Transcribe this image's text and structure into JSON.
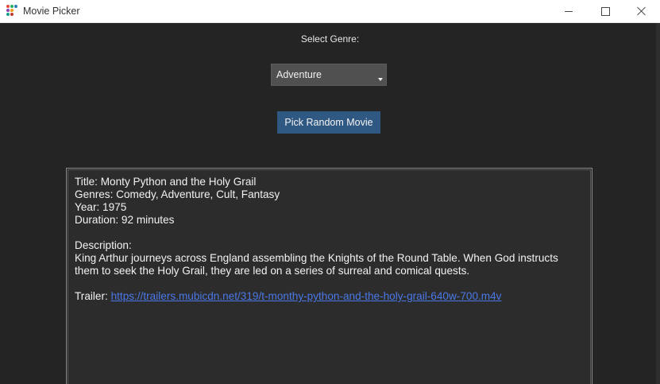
{
  "window": {
    "title": "Movie Picker",
    "icon": "app-dots-icon",
    "controls": [
      "minimize-icon",
      "maximize-icon",
      "close-icon"
    ]
  },
  "genre": {
    "label": "Select Genre:",
    "selected": "Adventure"
  },
  "actions": {
    "pick_label": "Pick Random Movie"
  },
  "movie": {
    "title_line": "Title: Monty Python and the Holy Grail",
    "genres_line": "Genres: Comedy, Adventure, Cult, Fantasy",
    "year_line": "Year: 1975",
    "duration_line": "Duration: 92 minutes",
    "description_heading": "Description:",
    "description": "King Arthur journeys across England assembling the Knights of the Round Table. When God instructs them to seek the Holy Grail, they are led on a series of surreal and comical quests.",
    "trailer_label": "Trailer:",
    "trailer_url": "https://trailers.mubicdn.net/319/t-monthy-python-and-the-holy-grail-640w-700.m4v"
  },
  "colors": {
    "background": "#242424",
    "button": "#2f5883",
    "link": "#4a78e8",
    "dropdown": "#505050"
  }
}
